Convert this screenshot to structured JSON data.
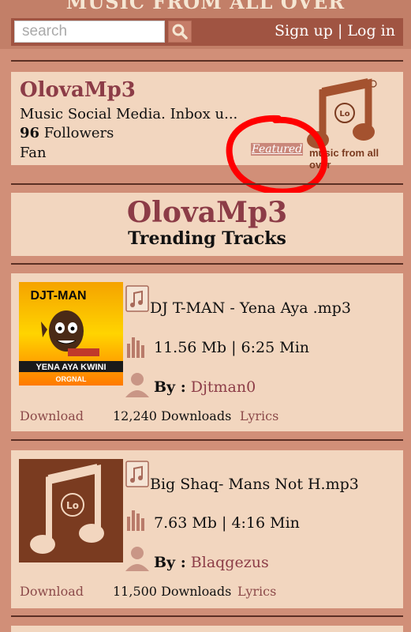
{
  "header": {
    "banner": "MUSIC FROM ALL OVER",
    "search_placeholder": "search",
    "sign_up": "Sign up",
    "separator": "|",
    "log_in": "Log in"
  },
  "profile": {
    "name": "OlovaMp3",
    "description": "Music Social Media. Inbox u...",
    "followers_count": "96",
    "followers_label": "Followers",
    "role": "Fan",
    "featured": "Featured",
    "logo_tagline": "music from all over",
    "logo_text": "Lo"
  },
  "section": {
    "title": "OlovaMp3",
    "subtitle": "Trending Tracks"
  },
  "tracks": [
    {
      "title": "DJ T-MAN - Yena Aya .mp3",
      "meta": "11.56 Mb | 6:25 Min",
      "by_label": "By :",
      "artist": "Djtman0",
      "download": "Download",
      "downloads": "12,240 Downloads",
      "lyrics": "Lyrics",
      "cover_top": "DJT-MAN",
      "cover_bottom": "YENA AYA KWINI",
      "cover_tag": "ORGNAL"
    },
    {
      "title": "Big Shaq- Mans Not H.mp3",
      "meta": "7.63 Mb | 4:16 Min",
      "by_label": "By :",
      "artist": "Blaqgezus",
      "download": "Download",
      "downloads": "11,500 Downloads",
      "lyrics": "Lyrics",
      "cover_text": "Lo"
    }
  ],
  "colors": {
    "background": "#d18f78",
    "card": "#f2d6bf",
    "accent": "#8c3c47",
    "annotation": "#ff0000"
  }
}
